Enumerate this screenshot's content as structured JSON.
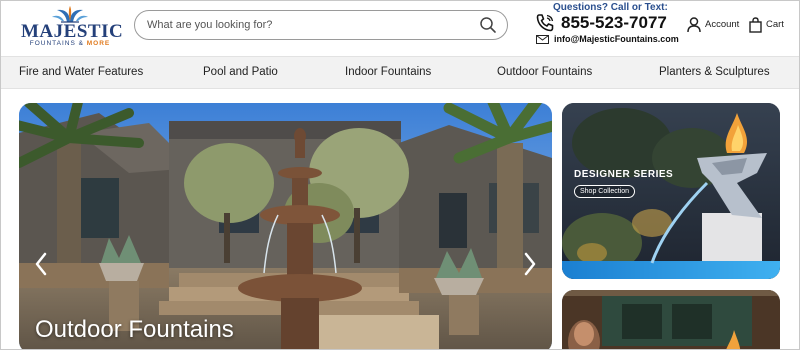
{
  "header": {
    "logo": {
      "name": "MAJESTIC",
      "tagline_prefix": "FOUNTAINS & ",
      "tagline_accent": "MORE"
    },
    "search": {
      "placeholder": "What are you looking for?",
      "value": ""
    },
    "contact": {
      "question": "Questions? Call or Text:",
      "phone": "855-523-7077",
      "email": "info@MajesticFountains.com"
    },
    "account_label": "Account",
    "cart_label": "Cart"
  },
  "nav": {
    "items": [
      {
        "label": "Fire and Water Features"
      },
      {
        "label": "Pool and Patio"
      },
      {
        "label": "Indoor Fountains"
      },
      {
        "label": "Outdoor Fountains"
      },
      {
        "label": "Planters & Sculptures"
      }
    ]
  },
  "hero": {
    "title": "Outdoor Fountains",
    "prev_icon": "chevron-left-icon",
    "next_icon": "chevron-right-icon"
  },
  "promos": {
    "designer": {
      "title": "DESIGNER SERIES",
      "button": "Shop Collection"
    }
  },
  "colors": {
    "brand_blue": "#24407a",
    "accent_orange": "#e07a1e",
    "contact_blue": "#2a4f8e",
    "nav_bg": "#f2f2f2"
  }
}
